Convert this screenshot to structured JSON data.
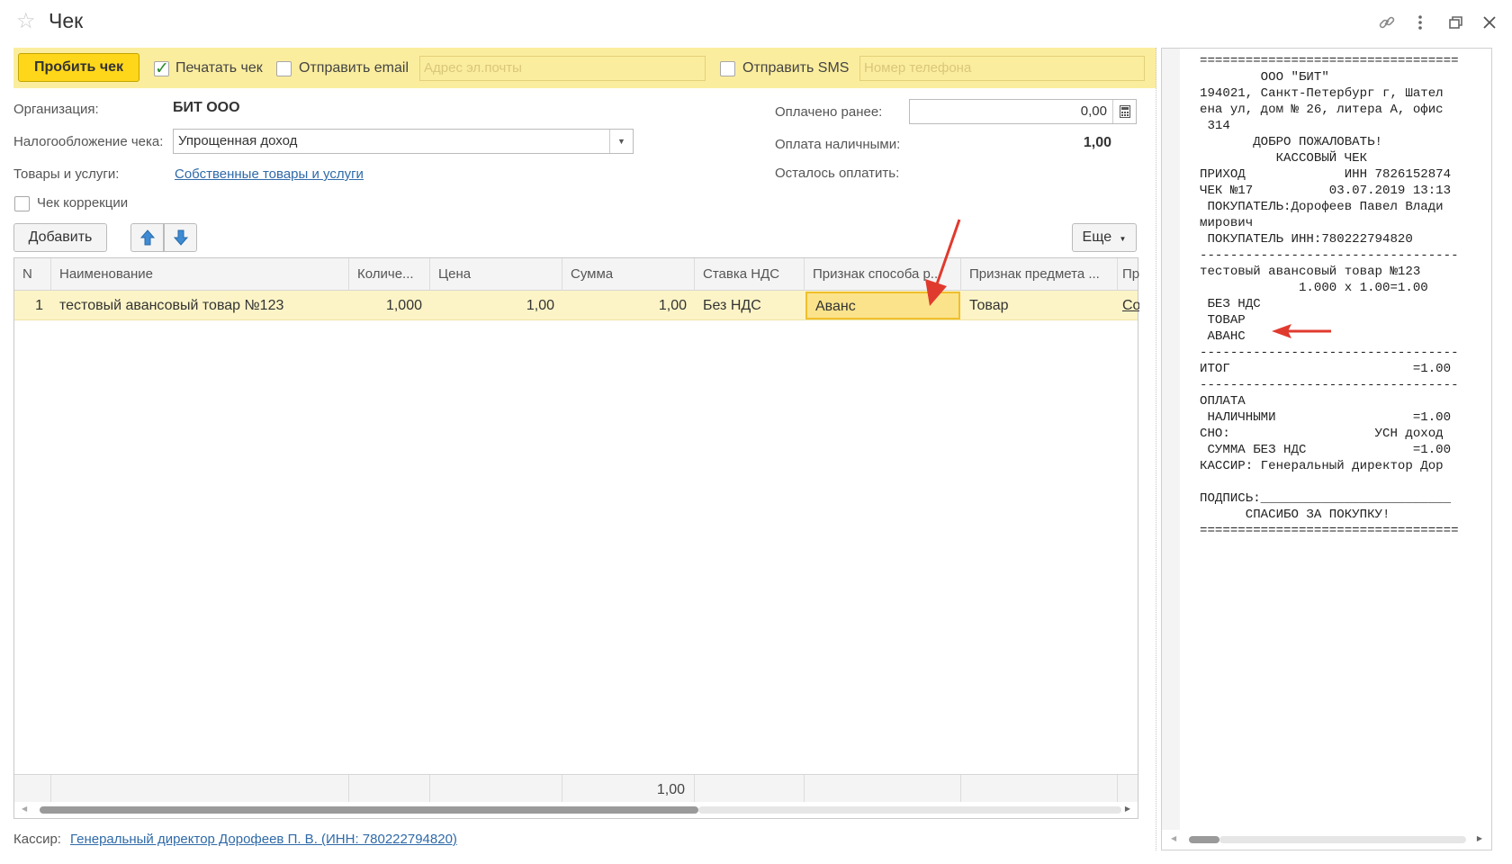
{
  "window": {
    "title": "Чек"
  },
  "toolbar": {
    "submit_label": "Пробить чек",
    "print_label": "Печатать чек",
    "print_checked": true,
    "email_label": "Отправить email",
    "email_checked": false,
    "email_placeholder": "Адрес эл.почты",
    "sms_label": "Отправить SMS",
    "sms_checked": false,
    "sms_placeholder": "Номер телефона"
  },
  "form": {
    "org_label": "Организация:",
    "org_value": "БИТ ООО",
    "tax_label": "Налогообложение чека:",
    "tax_value": "Упрощенная доход",
    "goods_label": "Товары и услуги:",
    "goods_link": "Собственные товары и услуги",
    "correction_label": "Чек коррекции",
    "paid_before_label": "Оплачено ранее:",
    "paid_before_value": "0,00",
    "cash_label": "Оплата наличными:",
    "cash_value": "1,00",
    "remaining_label": "Осталось оплатить:"
  },
  "table_toolbar": {
    "add_label": "Добавить",
    "more_label": "Еще"
  },
  "table": {
    "headers": [
      "N",
      "Наименование",
      "Количе...",
      "Цена",
      "Сумма",
      "Ставка НДС",
      "Признак способа р...",
      "Признак предмета ...",
      "Пр"
    ],
    "row": {
      "n": "1",
      "name": "тестовый авансовый товар №123",
      "qty": "1,000",
      "price": "1,00",
      "sum": "1,00",
      "vat": "Без НДС",
      "method": "Аванс",
      "subject": "Товар",
      "extra": "Со"
    },
    "footer_sum": "1,00"
  },
  "cashier": {
    "label": "Кассир:",
    "value": "Генеральный директор Дорофеев П. В. (ИНН: 780222794820)"
  },
  "receipt": {
    "lines": [
      "==================================",
      "        ООО \"БИТ\"",
      "194021, Санкт-Петербург г, Шател",
      "ена ул, дом № 26, литера А, офис",
      " 314",
      "       ДОБРО ПОЖАЛОВАТЬ!",
      "          КАССОВЫЙ ЧЕК",
      "ПРИХОД             ИНН 7826152874",
      "ЧЕК №17          03.07.2019 13:13",
      " ПОКУПАТЕЛЬ:Дорофеев Павел Влади",
      "мирович",
      " ПОКУПАТЕЛЬ ИНН:780222794820",
      "----------------------------------",
      "тестовый авансовый товар №123",
      "             1.000 х 1.00=1.00",
      " БЕЗ НДС",
      " ТОВАР",
      " АВАНС",
      "----------------------------------",
      "ИТОГ                        =1.00",
      "----------------------------------",
      "ОПЛАТА",
      " НАЛИЧНЫМИ                  =1.00",
      "СНО:                   УСН доход",
      " СУММА БЕЗ НДС              =1.00",
      "КАССИР: Генеральный директор Дор",
      "",
      "ПОДПИСЬ:_________________________",
      "      СПАСИБО ЗА ПОКУПКУ!",
      "=================================="
    ]
  },
  "icons": {
    "favorite": "star-icon",
    "link": "link-icon",
    "menu": "more-vertical-icon",
    "restore": "restore-window-icon",
    "close": "close-icon",
    "calc": "calculator-icon",
    "up": "arrow-up-icon",
    "down": "arrow-down-icon"
  },
  "colors": {
    "toolbar_bg": "#fbed9e",
    "primary_button": "#ffd71a",
    "selected_row": "#fcf4c6",
    "link": "#2f6aa8",
    "annotation_arrow": "#e03a2e"
  }
}
